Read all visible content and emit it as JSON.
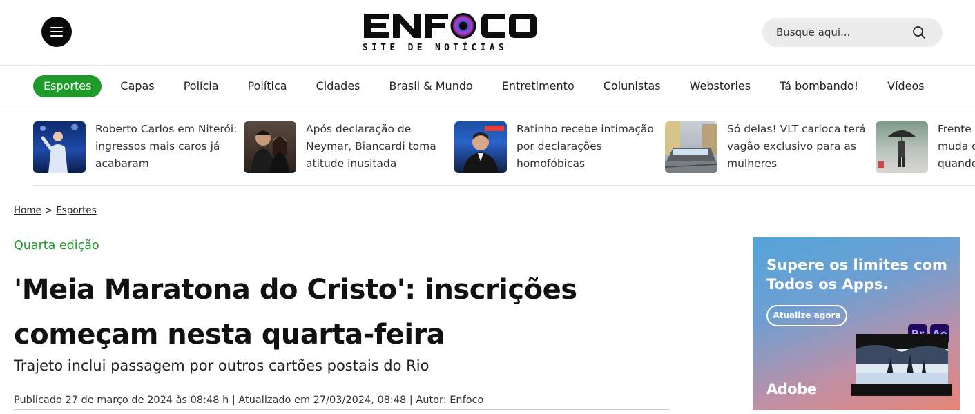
{
  "header": {
    "logo_text": "ENFOCO",
    "logo_tagline": "SITE DE NOTÍCIAS",
    "search_placeholder": "Busque aqui..."
  },
  "nav": {
    "items": [
      {
        "label": "Esportes",
        "active": true
      },
      {
        "label": "Capas"
      },
      {
        "label": "Polícia"
      },
      {
        "label": "Política"
      },
      {
        "label": "Cidades"
      },
      {
        "label": "Brasil & Mundo"
      },
      {
        "label": "Entretimento"
      },
      {
        "label": "Colunistas"
      },
      {
        "label": "Webstories"
      },
      {
        "label": "Tá bombando!"
      },
      {
        "label": "Vídeos"
      }
    ]
  },
  "trending": [
    {
      "title": "Roberto Carlos em Niterói: ingressos mais caros já acabaram",
      "thumb": "concert-singer-photo"
    },
    {
      "title": "Após declaração de Neymar, Biancardi toma atitude inusitada",
      "thumb": "couple-photo"
    },
    {
      "title": "Ratinho recebe intimação por declarações homofóbicas",
      "thumb": "tv-host-photo"
    },
    {
      "title": "Só delas! VLT carioca terá vagão exclusivo para as mulheres",
      "thumb": "tram-photo"
    },
    {
      "title": "Frente fria traz chuva e muda o tempo no Rio; veja quando",
      "thumb": "rain-umbrella-photo"
    }
  ],
  "breadcrumb": {
    "home": "Home",
    "separator": ">",
    "current": "Esportes"
  },
  "article": {
    "kicker": "Quarta edição",
    "headline": "'Meia Maratona do Cristo': inscrições começam nesta quarta-feira",
    "subhead": "Trajeto inclui passagem por outros cartões postais do Rio",
    "meta": "Publicado 27 de março de 2024 às 08:48 h | Atualizado em 27/03/2024, 08:48 | Autor: Enfoco"
  },
  "ad": {
    "headline": "Supere os limites com Todos os Apps.",
    "button": "Atualize agora",
    "app1": "Pr",
    "app2": "Ae",
    "brand": "Adobe"
  },
  "colors": {
    "accent_green": "#1e9a2a",
    "text": "#111111",
    "divider": "#e2e2e2"
  }
}
